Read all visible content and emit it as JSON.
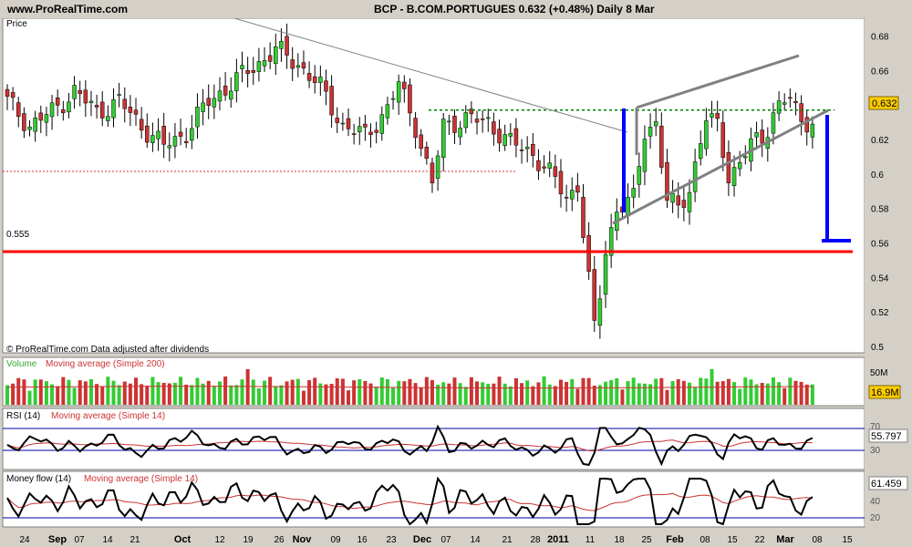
{
  "header": {
    "site": "www.ProRealTime.com",
    "title": "BCP - B.COM.PORTUGUES   0.632 (+0.48%)   Daily  8 Mar"
  },
  "panels": {
    "price_label": "Price",
    "price_note": "© ProRealTime.com  Data adjusted after dividends",
    "support_label": "0.555",
    "current_value_label": "0.632",
    "volume_label": "Volume",
    "volume_ma_label": "Moving average (Simple 200)",
    "volume_value_label": "16.9M",
    "volume_tick_label": "50M",
    "rsi_label": "RSI (14)",
    "rsi_ma_label": "Moving average (Simple 14)",
    "rsi_value_label": "55.797",
    "mf_label": "Money flow (14)",
    "mf_ma_label": "Moving average (Simple 14)",
    "mf_value_label": "61.459"
  },
  "colors": {
    "up": "#33cc33",
    "down": "#cc3333",
    "support": "#ff0000",
    "resistance": "#008000",
    "target": "#0000ff",
    "trend": "#808080",
    "ma": "#cc3333"
  },
  "chart_data": [
    {
      "type": "candlestick",
      "ylim": [
        0.5,
        0.685
      ],
      "y_ticks": [
        0.68,
        0.66,
        0.64,
        0.62,
        0.6,
        0.58,
        0.56,
        0.54,
        0.52,
        0.5
      ],
      "x_ticks": [
        "24",
        "Sep",
        "07",
        "14",
        "21",
        "Oct",
        "12",
        "19",
        "26",
        "Nov",
        "09",
        "16",
        "23",
        "Dec",
        "07",
        "14",
        "21",
        "28",
        "2011",
        "11",
        "18",
        "25",
        "Feb",
        "08",
        "15",
        "22",
        "Mar",
        "08",
        "15"
      ],
      "close_points": [
        [
          0,
          0.642
        ],
        [
          4,
          0.628
        ],
        [
          8,
          0.636
        ],
        [
          12,
          0.648
        ],
        [
          16,
          0.636
        ],
        [
          20,
          0.642
        ],
        [
          24,
          0.628
        ],
        [
          28,
          0.616
        ],
        [
          32,
          0.624
        ],
        [
          36,
          0.642
        ],
        [
          40,
          0.652
        ],
        [
          44,
          0.662
        ],
        [
          48,
          0.672
        ],
        [
          52,
          0.664
        ],
        [
          56,
          0.65
        ],
        [
          60,
          0.628
        ],
        [
          64,
          0.622
        ],
        [
          68,
          0.638
        ],
        [
          70,
          0.652
        ],
        [
          73,
          0.628
        ],
        [
          76,
          0.594
        ],
        [
          78,
          0.628
        ],
        [
          82,
          0.632
        ],
        [
          86,
          0.63
        ],
        [
          90,
          0.618
        ],
        [
          94,
          0.612
        ],
        [
          98,
          0.596
        ],
        [
          100,
          0.586
        ],
        [
          102,
          0.594
        ],
        [
          104,
          0.538
        ],
        [
          105,
          0.51
        ],
        [
          106,
          0.53
        ],
        [
          107,
          0.556
        ],
        [
          109,
          0.58
        ],
        [
          112,
          0.585
        ],
        [
          114,
          0.625
        ],
        [
          116,
          0.63
        ],
        [
          118,
          0.584
        ],
        [
          120,
          0.58
        ],
        [
          122,
          0.592
        ],
        [
          125,
          0.632
        ],
        [
          127,
          0.628
        ],
        [
          129,
          0.6
        ],
        [
          131,
          0.605
        ],
        [
          133,
          0.618
        ],
        [
          135,
          0.62
        ],
        [
          137,
          0.636
        ],
        [
          140,
          0.644
        ],
        [
          142,
          0.63
        ],
        [
          144,
          0.632
        ]
      ],
      "support": 0.555,
      "resistance": 0.637,
      "last": 0.632
    },
    {
      "type": "bar",
      "name": "Volume",
      "ma": "Simple 200"
    },
    {
      "type": "line",
      "name": "RSI (14)",
      "levels": [
        30,
        70
      ],
      "last": 55.797
    },
    {
      "type": "line",
      "name": "Money flow (14)",
      "levels": [
        20,
        40
      ],
      "last": 61.459
    }
  ]
}
